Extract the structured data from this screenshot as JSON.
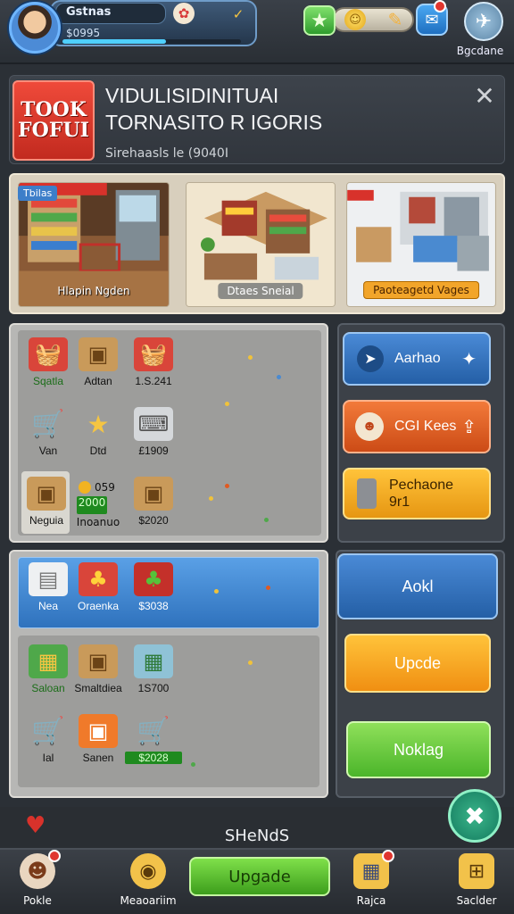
{
  "hud": {
    "player_name": "Gstnas",
    "cash": "$0995",
    "xp": 0.58,
    "settings_label": "Bgcdane"
  },
  "header": {
    "logo_line1": "TOOK",
    "logo_line2": "FOFUI",
    "title_line1": "VIDULISIDINITUAI",
    "title_line2": "TORNASITO R IGORIS",
    "subtitle": "Sirehaasls le (9040I"
  },
  "stores": {
    "tag": "Tbilas",
    "cards": [
      {
        "label": "Hlapin Ngden"
      },
      {
        "label": "Dtaes Sneial"
      },
      {
        "label": "Paoteagetd Vages"
      }
    ]
  },
  "inventory_top": [
    {
      "label": "Sqatla",
      "icon": "basket-icon",
      "green": true
    },
    {
      "label": "Adtan",
      "icon": "box-icon",
      "green": false
    },
    {
      "label": "1.S.241",
      "icon": "basket-icon",
      "green": false
    },
    {
      "label": "Van",
      "icon": "cart-icon",
      "green": false
    },
    {
      "label": "Dtd",
      "icon": "wand-icon",
      "green": false
    },
    {
      "label": "£1909",
      "icon": "register-icon",
      "green": false
    },
    {
      "label": "Neguia",
      "icon": "box-icon",
      "green": false
    },
    {
      "label": "Inoanuo",
      "icon": "coins-icon",
      "green": false
    },
    {
      "label": "$2020",
      "icon": "box-icon",
      "green": false
    }
  ],
  "coin_row": {
    "amount": "059",
    "price": "2000"
  },
  "actions_top": [
    {
      "label": "Aarhao",
      "color": "#2f6db8"
    },
    {
      "label": "CGI Kees",
      "color": "#e05a22"
    },
    {
      "label": "Pechaone",
      "sub": "9r1",
      "color": "#f0a41a"
    }
  ],
  "inventory_bottom": {
    "highlight": [
      {
        "label": "Nea",
        "icon": "fridge-icon"
      },
      {
        "label": "Oraenka",
        "icon": "produce-icon"
      },
      {
        "label": "$3038",
        "icon": "produce-icon"
      }
    ],
    "items": [
      {
        "label": "Saloan",
        "icon": "crate-icon",
        "green": true
      },
      {
        "label": "Smaltdiea",
        "icon": "box-icon",
        "green": false
      },
      {
        "label": "1S700",
        "icon": "crate-icon",
        "green": false
      },
      {
        "label": "Ial",
        "icon": "cart-icon",
        "green": false
      },
      {
        "label": "Sanen",
        "icon": "box-icon",
        "green": false
      },
      {
        "label": "$2028",
        "icon": "cart-icon",
        "green": false
      }
    ]
  },
  "actions_bottom": [
    {
      "label": "Aokl"
    },
    {
      "label": "Upcde"
    },
    {
      "label": "Noklag"
    }
  ],
  "bottom": {
    "label": "SHeNdS",
    "update_label": "Upgade",
    "nav": [
      {
        "label": "Pokle",
        "icon": "chef-icon"
      },
      {
        "label": "Meaoariim",
        "icon": "map-icon"
      },
      {
        "label": "Rajca",
        "icon": "calendar-icon"
      },
      {
        "label": "Saclder",
        "icon": "grid-icon"
      }
    ]
  }
}
